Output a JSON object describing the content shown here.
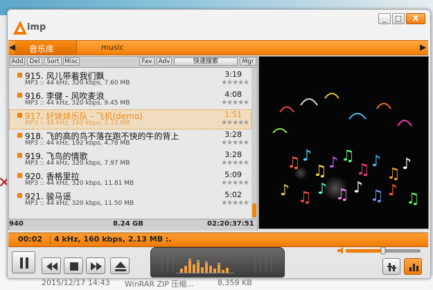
{
  "app": {
    "logo_text": "imp",
    "window_buttons": {
      "minimize": "_",
      "maximize": "□",
      "close": "X"
    }
  },
  "tabs": {
    "left_arrow": "◀",
    "right_arrow": "▶",
    "items": [
      {
        "label": "音乐库"
      },
      {
        "label": "music"
      }
    ]
  },
  "playlist_toolbar": {
    "add": "Add",
    "del": "Del",
    "sort": "Sort",
    "misc": "Misc",
    "fav": "Fav",
    "adv": "Adv",
    "search": "快速搜索",
    "mgr": "Mgr"
  },
  "tracks": [
    {
      "title": "915. 风儿带着我们飘",
      "duration": "3:19",
      "info": "MP3 :: 44 kHz, 320 kbps, 7.60 MB",
      "stars": "★★★★★"
    },
    {
      "title": "916. 李健 - 风吹麦浪",
      "duration": "4:08",
      "info": "MP3 :: 44 kHz, 320 kbps, 9.45 MB",
      "stars": "★★★★★"
    },
    {
      "title": "917. 好妹妹乐队 - 飞机(demo)",
      "duration": "1:51",
      "info": "MP3 :: 44 kHz, 160 kbps, 2.13 MB",
      "stars": "★★★★★"
    },
    {
      "title": "918. 飞的高的鸟不落在跑不快的牛的背上",
      "duration": "3:28",
      "info": "MP3 :: 44 kHz, 192 kbps, 4.78 MB",
      "stars": "★★★★★"
    },
    {
      "title": "919. 飞鸟的情歌",
      "duration": "3:28",
      "info": "MP3 :: 44 kHz, 320 kbps, 7.97 MB",
      "stars": "★★★★★"
    },
    {
      "title": "920. 香格里拉",
      "duration": "5:09",
      "info": "MP3 :: 44 kHz, 320 kbps, 11.81 MB",
      "stars": "★★★★★"
    },
    {
      "title": "921. 骏马谣",
      "duration": "5:02",
      "info": "MP3 :: 44 kHz, 320 kbps, 11.50 MB",
      "stars": "★★★★★"
    }
  ],
  "playlist_footer": {
    "count": "940",
    "size": "8.24 GB",
    "total_time": "02:20:37:51"
  },
  "status": {
    "time": "00:02",
    "scroll_text": "4 kHz, 160 kbps, 2.13 MB :."
  },
  "background_file": {
    "date": "2015/12/17 14:43",
    "type": "WinRAR ZIP 压缩...",
    "size": "8,359 KB"
  },
  "playback": {
    "volume": 0.5
  },
  "colors": {
    "accent": "#f0840c",
    "selected_text": "#f08a14"
  }
}
